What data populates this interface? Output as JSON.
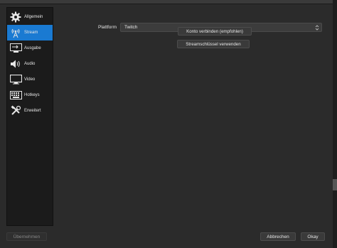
{
  "sidebar": {
    "items": [
      {
        "label": "Allgemein",
        "icon": "gear-icon",
        "active": false
      },
      {
        "label": "Stream",
        "icon": "antenna-icon",
        "active": true
      },
      {
        "label": "Ausgabe",
        "icon": "output-icon",
        "active": false
      },
      {
        "label": "Audio",
        "icon": "speaker-icon",
        "active": false
      },
      {
        "label": "Video",
        "icon": "monitor-icon",
        "active": false
      },
      {
        "label": "Hotkeys",
        "icon": "keyboard-icon",
        "active": false
      },
      {
        "label": "Erweitert",
        "icon": "tools-icon",
        "active": false
      }
    ]
  },
  "stream": {
    "platform_label": "Plattform",
    "platform_value": "Twitch",
    "connect_button": "Konto verbinden (empfohlen)",
    "streamkey_button": "Streamschlüssel verwenden"
  },
  "footer": {
    "apply_button": "Übernehmen",
    "cancel_button": "Abbrechen",
    "ok_button": "Okay"
  },
  "colors": {
    "accent": "#1a7ad2",
    "background": "#2b2b2b",
    "sidebar_bg": "#1b1b1b"
  }
}
